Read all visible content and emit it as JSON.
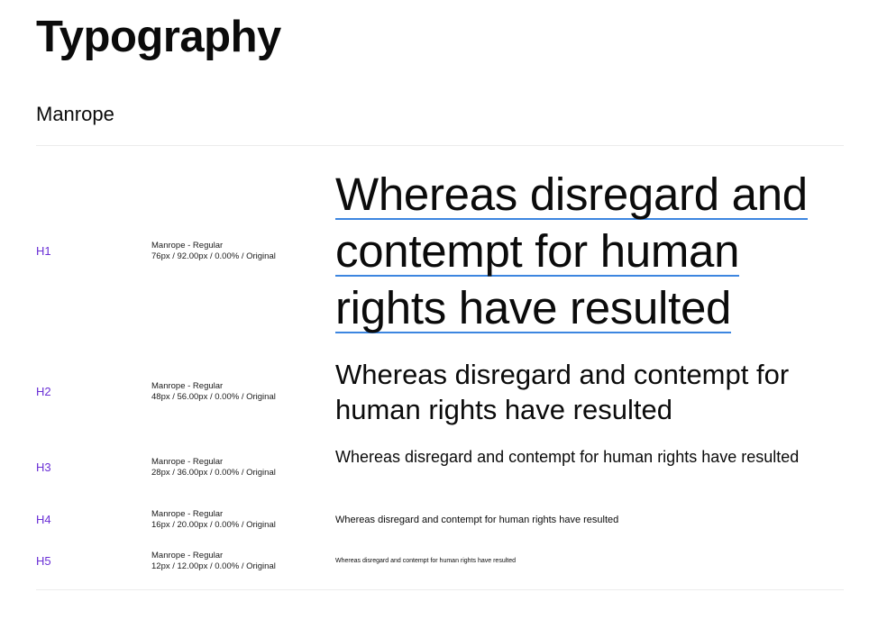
{
  "page": {
    "title": "Typography",
    "font_name": "Manrope"
  },
  "styles": [
    {
      "tag": "H1",
      "spec_name": "Manrope - Regular",
      "spec_metrics": "76px / 92.00px / 0.00% / Original",
      "sample_lines": [
        "Whereas disregard and",
        "contempt for human",
        "rights have resulted"
      ]
    },
    {
      "tag": "H2",
      "spec_name": "Manrope - Regular",
      "spec_metrics": "48px / 56.00px / 0.00% / Original",
      "sample": "Whereas disregard and contempt for human rights have resulted"
    },
    {
      "tag": "H3",
      "spec_name": "Manrope - Regular",
      "spec_metrics": "28px / 36.00px / 0.00% / Original",
      "sample": "Whereas disregard and contempt for human rights have resulted"
    },
    {
      "tag": "H4",
      "spec_name": "Manrope - Regular",
      "spec_metrics": "16px / 20.00px / 0.00% / Original",
      "sample": "Whereas disregard and contempt for human rights have resulted"
    },
    {
      "tag": "H5",
      "spec_name": "Manrope - Regular",
      "spec_metrics": "12px / 12.00px / 0.00% / Original",
      "sample": "Whereas disregard and contempt for human rights have resulted"
    }
  ],
  "colors": {
    "tag": "#6a2fd6",
    "text": "#0b0b0b",
    "divider": "#ececec",
    "underline": "#3d86e0"
  }
}
